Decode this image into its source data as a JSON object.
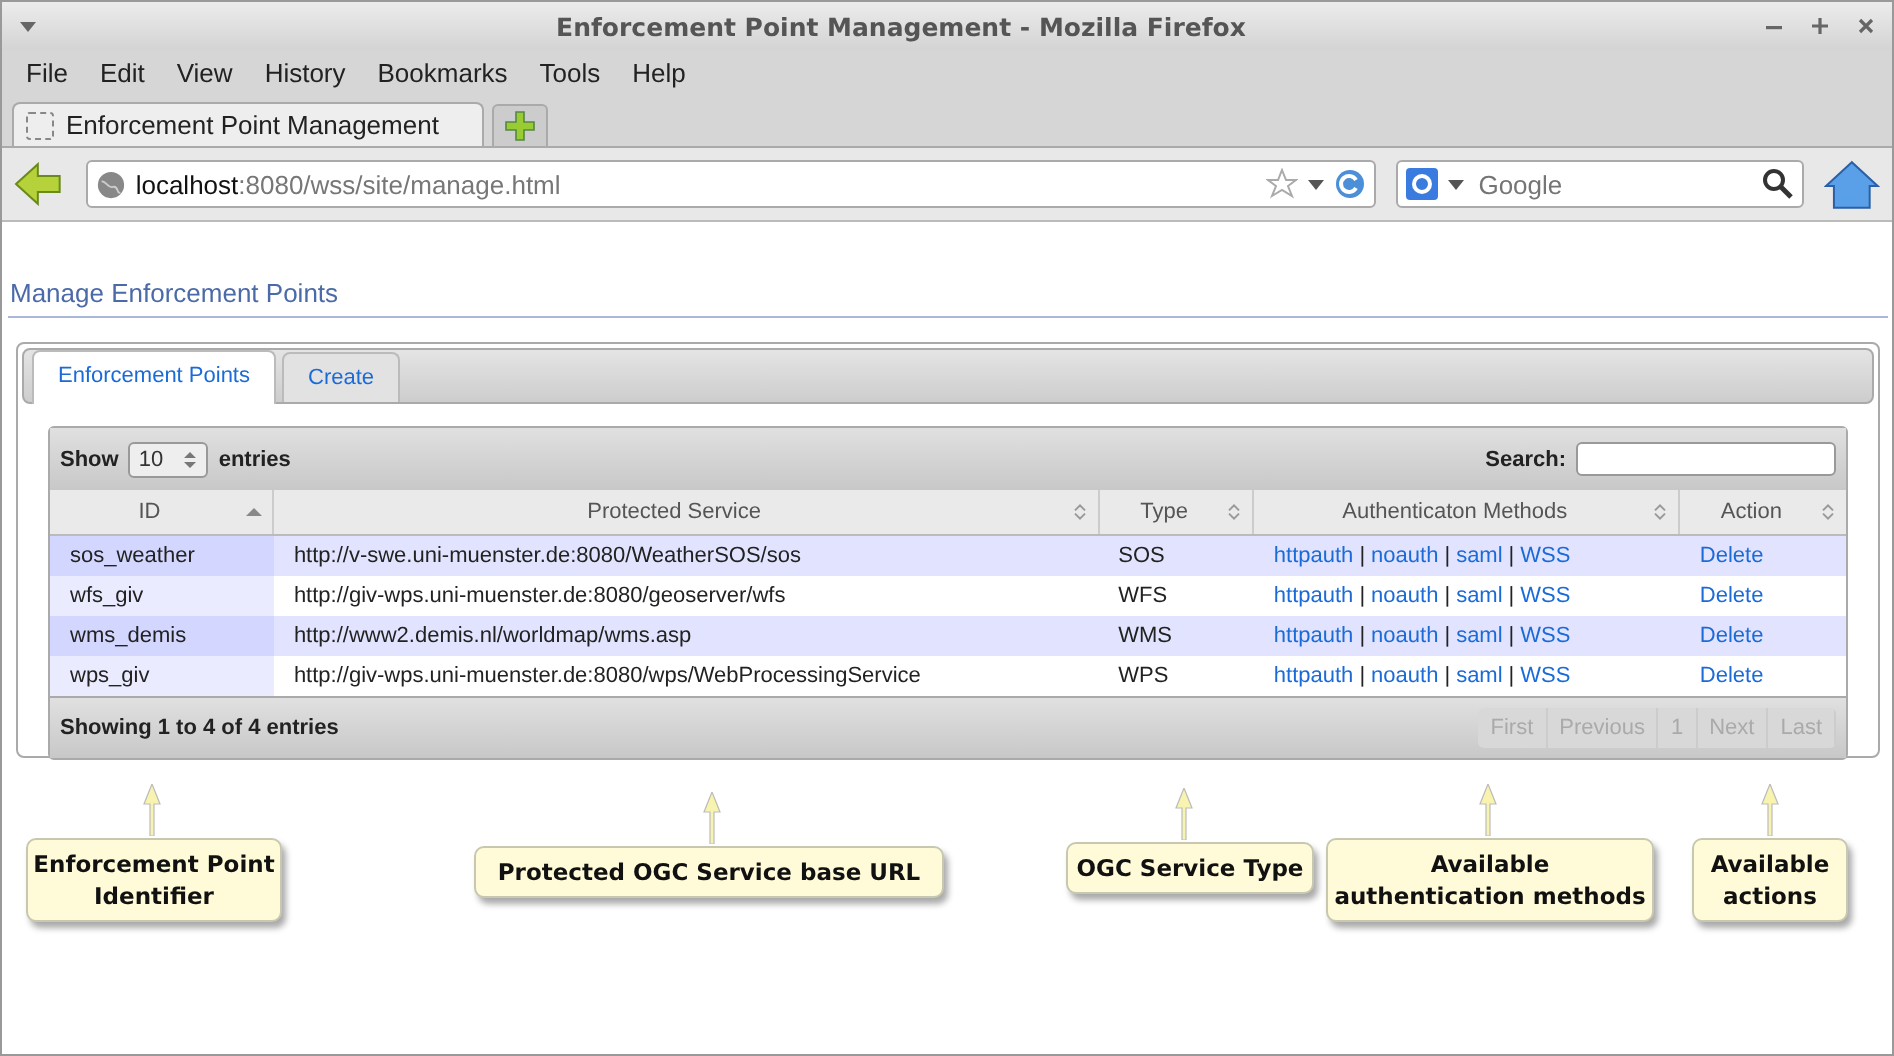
{
  "window": {
    "title": "Enforcement Point Management - Mozilla Firefox"
  },
  "menu": [
    "File",
    "Edit",
    "View",
    "History",
    "Bookmarks",
    "Tools",
    "Help"
  ],
  "browser_tabs": [
    {
      "label": "Enforcement Point Management",
      "selected": true
    }
  ],
  "address_bar": {
    "host": "localhost",
    "rest": ":8080/wss/site/manage.html"
  },
  "search_bar": {
    "placeholder": "Google"
  },
  "page": {
    "heading": "Manage Enforcement Points",
    "tabs": [
      {
        "label": "Enforcement Points",
        "selected": true
      },
      {
        "label": "Create",
        "selected": false
      }
    ],
    "length": {
      "prefix": "Show",
      "value": "10",
      "suffix": "entries"
    },
    "search": {
      "label": "Search:"
    },
    "table": {
      "separator": "|",
      "columns": [
        {
          "label": "ID",
          "sorted": true
        },
        {
          "label": "Protected Service",
          "sorted": false
        },
        {
          "label": "Type",
          "sorted": false
        },
        {
          "label": "Authenticaton Methods",
          "sorted": false
        },
        {
          "label": "Action",
          "sorted": false
        }
      ],
      "rows": [
        {
          "id": "sos_weather",
          "service": "http://v-swe.uni-muenster.de:8080/WeatherSOS/sos",
          "type": "SOS",
          "methods": [
            "httpauth",
            "noauth",
            "saml",
            "WSS"
          ],
          "action": "Delete"
        },
        {
          "id": "wfs_giv",
          "service": "http://giv-wps.uni-muenster.de:8080/geoserver/wfs",
          "type": "WFS",
          "methods": [
            "httpauth",
            "noauth",
            "saml",
            "WSS"
          ],
          "action": "Delete"
        },
        {
          "id": "wms_demis",
          "service": "http://www2.demis.nl/worldmap/wms.asp",
          "type": "WMS",
          "methods": [
            "httpauth",
            "noauth",
            "saml",
            "WSS"
          ],
          "action": "Delete"
        },
        {
          "id": "wps_giv",
          "service": "http://giv-wps.uni-muenster.de:8080/wps/WebProcessingService",
          "type": "WPS",
          "methods": [
            "httpauth",
            "noauth",
            "saml",
            "WSS"
          ],
          "action": "Delete"
        }
      ]
    },
    "info": "Showing 1 to 4 of 4 entries",
    "pagination": [
      {
        "label": "First",
        "disabled": true
      },
      {
        "label": "Previous",
        "disabled": true
      },
      {
        "label": "1",
        "disabled": true
      },
      {
        "label": "Next",
        "disabled": true
      },
      {
        "label": "Last",
        "disabled": true
      }
    ]
  },
  "callouts": [
    "Enforcement Point Identifier",
    "Protected OGC Service base URL",
    "OGC Service Type",
    "Available authentication methods",
    "Available actions"
  ]
}
